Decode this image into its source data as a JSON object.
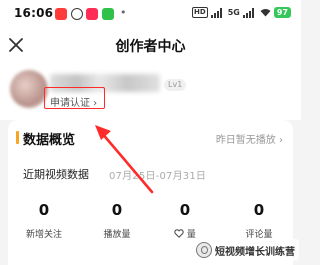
{
  "status_bar": {
    "time": "16:06",
    "network_badge": "HD",
    "network_type": "5G",
    "battery": "97",
    "more": "•"
  },
  "header": {
    "title": "创作者中心",
    "close_icon": "close-icon"
  },
  "profile": {
    "level": "Lv1",
    "certify_link": "申请认证 ›"
  },
  "data_overview": {
    "title": "数据概览",
    "status": "昨日暂无播放 ›",
    "range_label": "近期视频数据",
    "range_dates": "07月25日-07月31日",
    "metrics": [
      {
        "value": "0",
        "label": "新增关注"
      },
      {
        "value": "0",
        "label": "播放量"
      },
      {
        "value": "0",
        "label": "量"
      },
      {
        "value": "0",
        "label": "评论量"
      }
    ]
  },
  "watermark": {
    "text": "短视频增长训练营"
  },
  "colors": {
    "annotation_red": "#ff2a2a",
    "accent_orange": "#f5a623",
    "battery_green": "#35c759"
  }
}
